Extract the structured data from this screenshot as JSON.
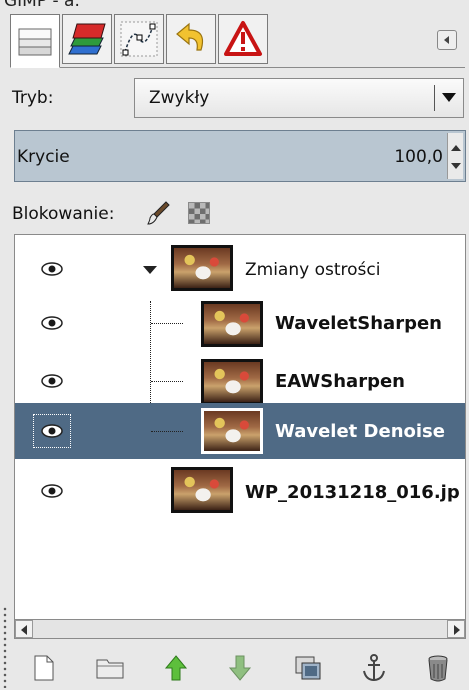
{
  "window": {
    "title_fragment": "GIMP - a."
  },
  "tabs": [
    {
      "name": "Warstwy",
      "icon": "layers-icon",
      "active": true
    },
    {
      "name": "Kanały",
      "icon": "channels-icon",
      "active": false
    },
    {
      "name": "Ścieżki",
      "icon": "paths-icon",
      "active": false
    },
    {
      "name": "Historia cofnięć",
      "icon": "undo-history-icon",
      "active": false
    },
    {
      "name": "Ostrzeżenia",
      "icon": "warning-icon",
      "active": false
    }
  ],
  "mode": {
    "label": "Tryb:",
    "value": "Zwykły"
  },
  "opacity": {
    "label": "Krycie",
    "value": "100,0"
  },
  "lock": {
    "label": "Blokowanie:"
  },
  "layers": [
    {
      "name": "Zmiany ostrości",
      "group": true,
      "level": 0,
      "selected": false
    },
    {
      "name": "WaveletSharpen",
      "group": false,
      "level": 1,
      "selected": false
    },
    {
      "name": "EAWSharpen",
      "group": false,
      "level": 1,
      "selected": false
    },
    {
      "name": "Wavelet Denoise",
      "group": false,
      "level": 1,
      "selected": true
    },
    {
      "name": "WP_20131218_016.jp",
      "group": false,
      "level": 0,
      "selected": false
    }
  ],
  "toolbar": {
    "buttons": [
      "new-layer-icon",
      "new-layer-group-icon",
      "raise-layer-icon",
      "lower-layer-icon",
      "duplicate-layer-icon",
      "anchor-layer-icon",
      "delete-layer-icon"
    ]
  },
  "colors": {
    "selection": "#4f6a85",
    "opacity_bg": "#b9c6d1",
    "panel_bg": "#e8e8e8"
  }
}
